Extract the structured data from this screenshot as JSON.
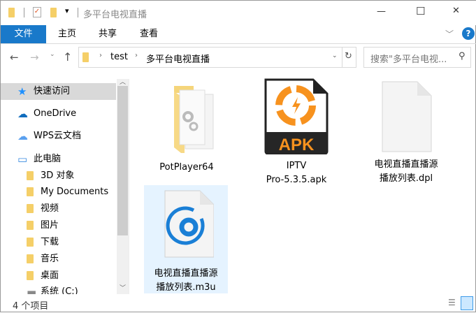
{
  "window": {
    "title": "多平台电视直播",
    "minimize": "—",
    "maximize": "☐",
    "close": "✕"
  },
  "ribbon": {
    "tabs": [
      "文件",
      "主页",
      "共享",
      "查看"
    ],
    "accent": "#1979ca",
    "help": "?"
  },
  "address": {
    "path": [
      "test",
      "多平台电视直播"
    ],
    "search_placeholder": "搜索\"多平台电视...",
    "refresh": "↻"
  },
  "nav": {
    "items": [
      {
        "label": "快速访问",
        "icon": "star-icon",
        "selected": true
      },
      {
        "label": "OneDrive",
        "icon": "cloud-icon"
      },
      {
        "label": "WPS云文档",
        "icon": "cloud-outline-icon"
      },
      {
        "label": "此电脑",
        "icon": "computer-icon"
      },
      {
        "label": "3D 对象",
        "icon": "3d-folder-icon"
      },
      {
        "label": "My Documents",
        "icon": "documents-folder-icon"
      },
      {
        "label": "视频",
        "icon": "videos-folder-icon"
      },
      {
        "label": "图片",
        "icon": "pictures-folder-icon"
      },
      {
        "label": "下载",
        "icon": "downloads-folder-icon"
      },
      {
        "label": "音乐",
        "icon": "music-folder-icon"
      },
      {
        "label": "桌面",
        "icon": "desktop-folder-icon"
      },
      {
        "label": "系统 (C:)",
        "icon": "drive-icon"
      }
    ]
  },
  "files": [
    {
      "name": "PotPlayer64",
      "type": "folder"
    },
    {
      "name": "IPTV Pro-5.3.5.apk",
      "line1": "IPTV",
      "line2": "Pro-5.3.5.apk",
      "type": "apk",
      "badge": "APK"
    },
    {
      "name": "电视直播直播源播放列表.dpl",
      "line1": "电视直播直播源",
      "line2": "播放列表.dpl",
      "type": "blank"
    },
    {
      "name": "电视直播直播源播放列表.m3u",
      "line1": "电视直播直播源",
      "line2": "播放列表.m3u",
      "type": "m3u",
      "selected": true
    }
  ],
  "status": {
    "count": "4 个项目"
  }
}
